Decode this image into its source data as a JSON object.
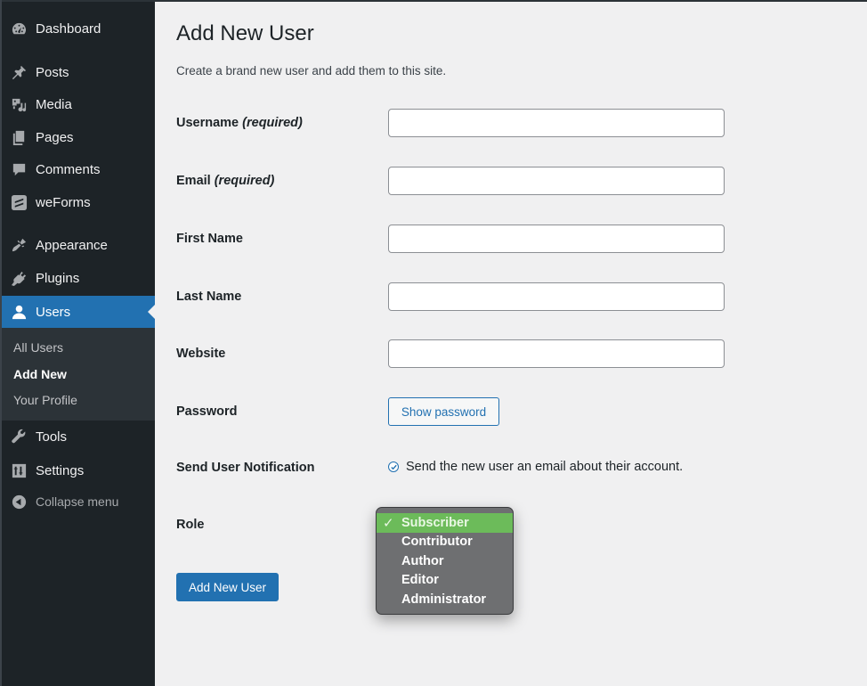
{
  "sidebar": {
    "items": [
      {
        "label": "Dashboard",
        "icon": "dashboard-icon"
      },
      {
        "label": "Posts",
        "icon": "pushpin-icon"
      },
      {
        "label": "Media",
        "icon": "media-icon"
      },
      {
        "label": "Pages",
        "icon": "pages-icon"
      },
      {
        "label": "Comments",
        "icon": "comment-icon"
      },
      {
        "label": "weForms",
        "icon": "weforms-icon"
      },
      {
        "label": "Appearance",
        "icon": "paintbrush-icon"
      },
      {
        "label": "Plugins",
        "icon": "plug-icon"
      },
      {
        "label": "Users",
        "icon": "user-icon",
        "active": true
      },
      {
        "label": "Tools",
        "icon": "wrench-icon"
      },
      {
        "label": "Settings",
        "icon": "settings-icon"
      }
    ],
    "submenu": [
      {
        "label": "All Users"
      },
      {
        "label": "Add New",
        "current": true
      },
      {
        "label": "Your Profile"
      }
    ],
    "collapse_label": "Collapse menu"
  },
  "main": {
    "title": "Add New User",
    "description": "Create a brand new user and add them to this site.",
    "fields": {
      "username": {
        "label": "Username",
        "note": "(required)",
        "value": ""
      },
      "email": {
        "label": "Email",
        "note": "(required)",
        "value": ""
      },
      "first_name": {
        "label": "First Name",
        "value": ""
      },
      "last_name": {
        "label": "Last Name",
        "value": ""
      },
      "website": {
        "label": "Website",
        "value": ""
      }
    },
    "password": {
      "label": "Password",
      "button": "Show password"
    },
    "notification": {
      "label": "Send User Notification",
      "checkbox_text": "Send the new user an email about their account.",
      "checked": true
    },
    "role": {
      "label": "Role",
      "selected": "Subscriber",
      "options": [
        "Subscriber",
        "Contributor",
        "Author",
        "Editor",
        "Administrator"
      ],
      "check_glyph": "✓"
    },
    "submit_label": "Add New User"
  },
  "colors": {
    "sidebar_bg": "#1d2327",
    "accent": "#2271b1",
    "selected_option": "#6cbb5a",
    "page_bg": "#f0f0f1"
  }
}
